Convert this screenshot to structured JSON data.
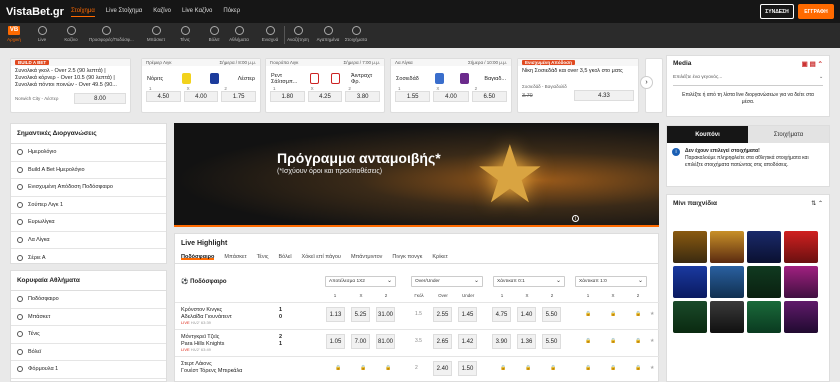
{
  "header": {
    "logo": "VistaBet.gr",
    "nav": [
      "Στοίχημα",
      "Live Στοίχημα",
      "Καζίνο",
      "Live Καζίνο",
      "Πόκερ"
    ],
    "login": "ΣΥΝΔΕΣΗ",
    "register": "ΕΓΓΡΑΦΗ"
  },
  "sports": [
    "Αρχική",
    "Live",
    "Καζίνο",
    "Προσφορές/Ποδόσφ...",
    "Μπάσκετ",
    "Τένις",
    "Βόλεϊ",
    "Αθλήματα",
    "Ενισχυά",
    "Αναζήτηση",
    "Αγαπημένα",
    "Στοιχήματα"
  ],
  "cards": {
    "c1": {
      "badge": "BUILD A BET",
      "text": "Συνολικά γκολ - Over 2.5 (90 λεπτά) | Συνολικά κόρνερ - Over 10.5 (90 λεπτά) | Συνολικά πόντοι ποινών - Over 49.5 (90...",
      "match": "Norwich City - Λέστερ",
      "odd": "8.00"
    },
    "c2": {
      "league": "Πρέμιερ Λιγκ",
      "time": "Σήμερα / 8:00 μ.μ.",
      "home": "Νόριτς",
      "away": "Λέστερ",
      "o1": "4.50",
      "ox": "4.00",
      "o2": "1.75"
    },
    "c3": {
      "league": "Γιουρόπα Λιγκ",
      "time": "Σήμερα / 7:00 μ.μ.",
      "home": "Ρεντ Σάλτσμπ...",
      "away": "Άιντραχτ Φρ.",
      "o1": "1.80",
      "ox": "4.25",
      "o2": "3.80"
    },
    "c4": {
      "league": "Λα Λίγκα",
      "time": "Σήμερα / 10:00 μ.μ.",
      "home": "Σοσιεδάδ",
      "away": "Βαγιαδ...",
      "o1": "1.55",
      "ox": "4.00",
      "o2": "6.50"
    },
    "c5": {
      "badge": "Ενισχυμένη Απόδοση",
      "text": "Νίκη Σοσιεδάδ και over 3,5 γκολ στο ματς",
      "match": "Σοσιεδάδ - Βαγιαδολίδ",
      "old": "3.70",
      "odd": "4.33"
    }
  },
  "left1": {
    "title": "Σημαντικές Διοργανώσεις",
    "items": [
      "Ημερολόγιο",
      "Build A Bet Ημερολόγιο",
      "Ενισχυμένη Απόδοση Ποδόσφαιρο",
      "Σούπερ Λιγκ 1",
      "Ευρωλίγκα",
      "Λα Λίγκα",
      "Σέριε Α"
    ]
  },
  "left2": {
    "title": "Κορυφαία Αθλήματα",
    "items": [
      "Ποδόσφαιρο",
      "Μπάσκετ",
      "Τένις",
      "Βόλεϊ",
      "Φόρμουλα 1",
      "Γκολφ"
    ]
  },
  "banner": {
    "title": "Πρόγραμμα ανταμοιβής*",
    "sub": "(*Ισχύουν όροι και προϋποθέσεις)"
  },
  "live": {
    "title": "Live Highlight",
    "tabs": [
      "Ποδόσφαιρο",
      "Μπάσκετ",
      "Τένις",
      "Βόλεϊ",
      "Χόκεϊ επί πάγου",
      "Μπάντμιντον",
      "Πινγκ πονγκ",
      "Κρίκετ"
    ],
    "sport": "Ποδόσφαιρο",
    "markets": [
      "Αποτέλεσμα 1Χ2",
      "Over/Under",
      "Χάντικαπ 0:1",
      "Χάντικαπ 1:0"
    ],
    "cols": [
      "1",
      "Χ",
      "2",
      "Γκόλ",
      "Over",
      "Under",
      "1",
      "Χ",
      "2",
      "1",
      "Χ",
      "2"
    ],
    "rows": [
      {
        "home": "Κρόνστον Κινγκς",
        "away": "Αδελαΐδα Γιουνάιτεντ",
        "live": "LIVE",
        "min": "Ηλ/2' 63:39",
        "s1": "1",
        "s2": "0",
        "o": [
          "1.13",
          "5.25",
          "31.00"
        ],
        "g": "1.5",
        "ou": [
          "2.55",
          "1.45"
        ],
        "h": [
          "4.75",
          "1.40",
          "5.50"
        ]
      },
      {
        "home": "Μόντγκρεϊ Τζεϊς",
        "away": "Para Hills Knights",
        "live": "LIVE",
        "min": "Ηλ/2' 63:49",
        "s1": "2",
        "s2": "1",
        "o": [
          "1.05",
          "7.00",
          "81.00"
        ],
        "g": "3.5",
        "ou": [
          "2.65",
          "1.42"
        ],
        "h": [
          "3.90",
          "1.36",
          "5.50"
        ]
      },
      {
        "home": "Στερτ Λάιονς",
        "away": "Γουέστ Τόρενς Μπιρκάλα",
        "live": "LIVE",
        "min": "",
        "s1": "",
        "s2": "",
        "o": [
          "",
          "",
          ""
        ],
        "g": "2",
        "ou": [
          "2.40",
          "1.50"
        ],
        "h": [
          "",
          "",
          ""
        ]
      }
    ]
  },
  "right": {
    "media_title": "Media",
    "media_select": "Επιλέξτε ένα γεγονός...",
    "media_text": "Επιλέξτε ή από τη λίστα live διοργανώσεων για να δείτε στα μέσα.",
    "tab1": "Κουπόνι",
    "tab2": "Στοιχήματα",
    "coupon_title": "Δεν έχουν επιλεγεί στοιχήματα!",
    "coupon_text": "Παρακαλούμε πληρηφλείτε στα αθλητικά στοιχήματα και επιλέξτε στοιχήματα πατώντας στις αποδόσεις.",
    "mini_title": "Μίνι παιχνίδια"
  }
}
